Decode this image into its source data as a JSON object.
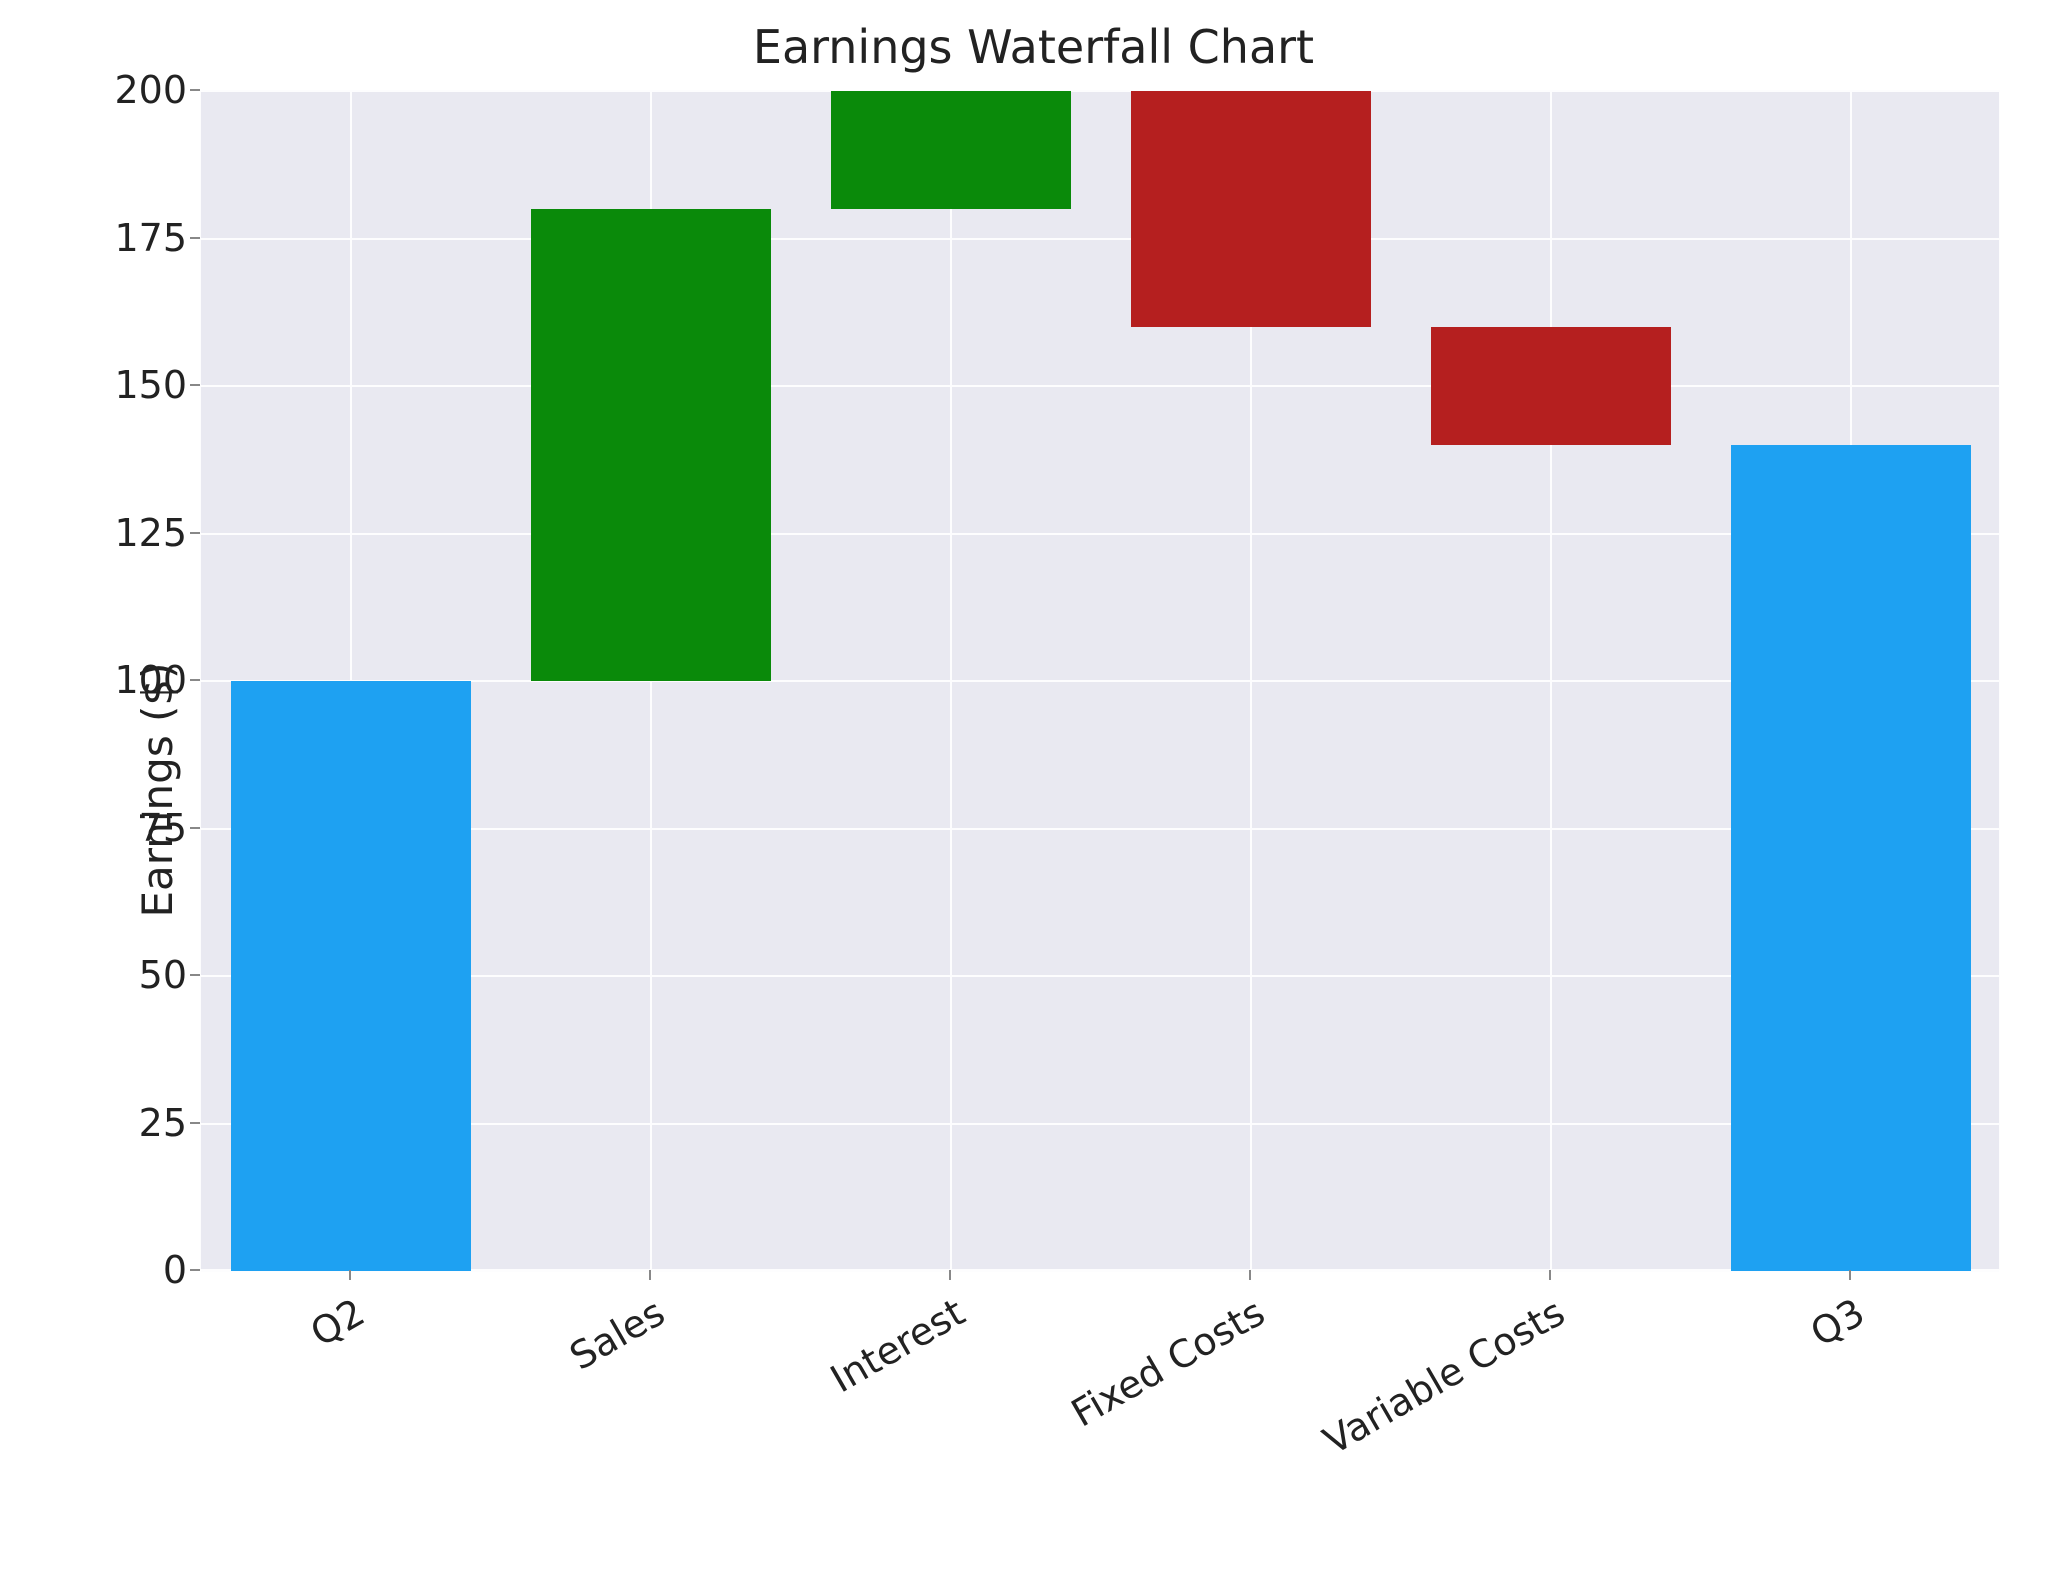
{
  "chart_data": {
    "type": "bar",
    "title": "Earnings Waterfall Chart",
    "xlabel": "",
    "ylabel": "Earnings ($)",
    "ylim": [
      0,
      200
    ],
    "yticks": [
      0,
      25,
      50,
      75,
      100,
      125,
      150,
      175,
      200
    ],
    "categories": [
      "Q2",
      "Sales",
      "Interest",
      "Fixed Costs",
      "Variable Costs",
      "Q3"
    ],
    "bars": [
      {
        "label": "Q2",
        "bottom": 0,
        "top": 100,
        "value": 100,
        "kind": "total"
      },
      {
        "label": "Sales",
        "bottom": 100,
        "top": 180,
        "value": 80,
        "kind": "increase"
      },
      {
        "label": "Interest",
        "bottom": 180,
        "top": 200,
        "value": 20,
        "kind": "increase"
      },
      {
        "label": "Fixed Costs",
        "bottom": 160,
        "top": 200,
        "value": -40,
        "kind": "decrease"
      },
      {
        "label": "Variable Costs",
        "bottom": 140,
        "top": 160,
        "value": -20,
        "kind": "decrease"
      },
      {
        "label": "Q3",
        "bottom": 0,
        "top": 140,
        "value": 140,
        "kind": "total"
      }
    ],
    "colors": {
      "total": "#1ea1f2",
      "increase": "#0a8a0a",
      "decrease": "#b51f1f",
      "grid_bg": "#e9e9f1",
      "grid_line": "#fdfdfe"
    },
    "bar_width_fraction": 0.8,
    "x_tick_rotation_deg": 30
  }
}
